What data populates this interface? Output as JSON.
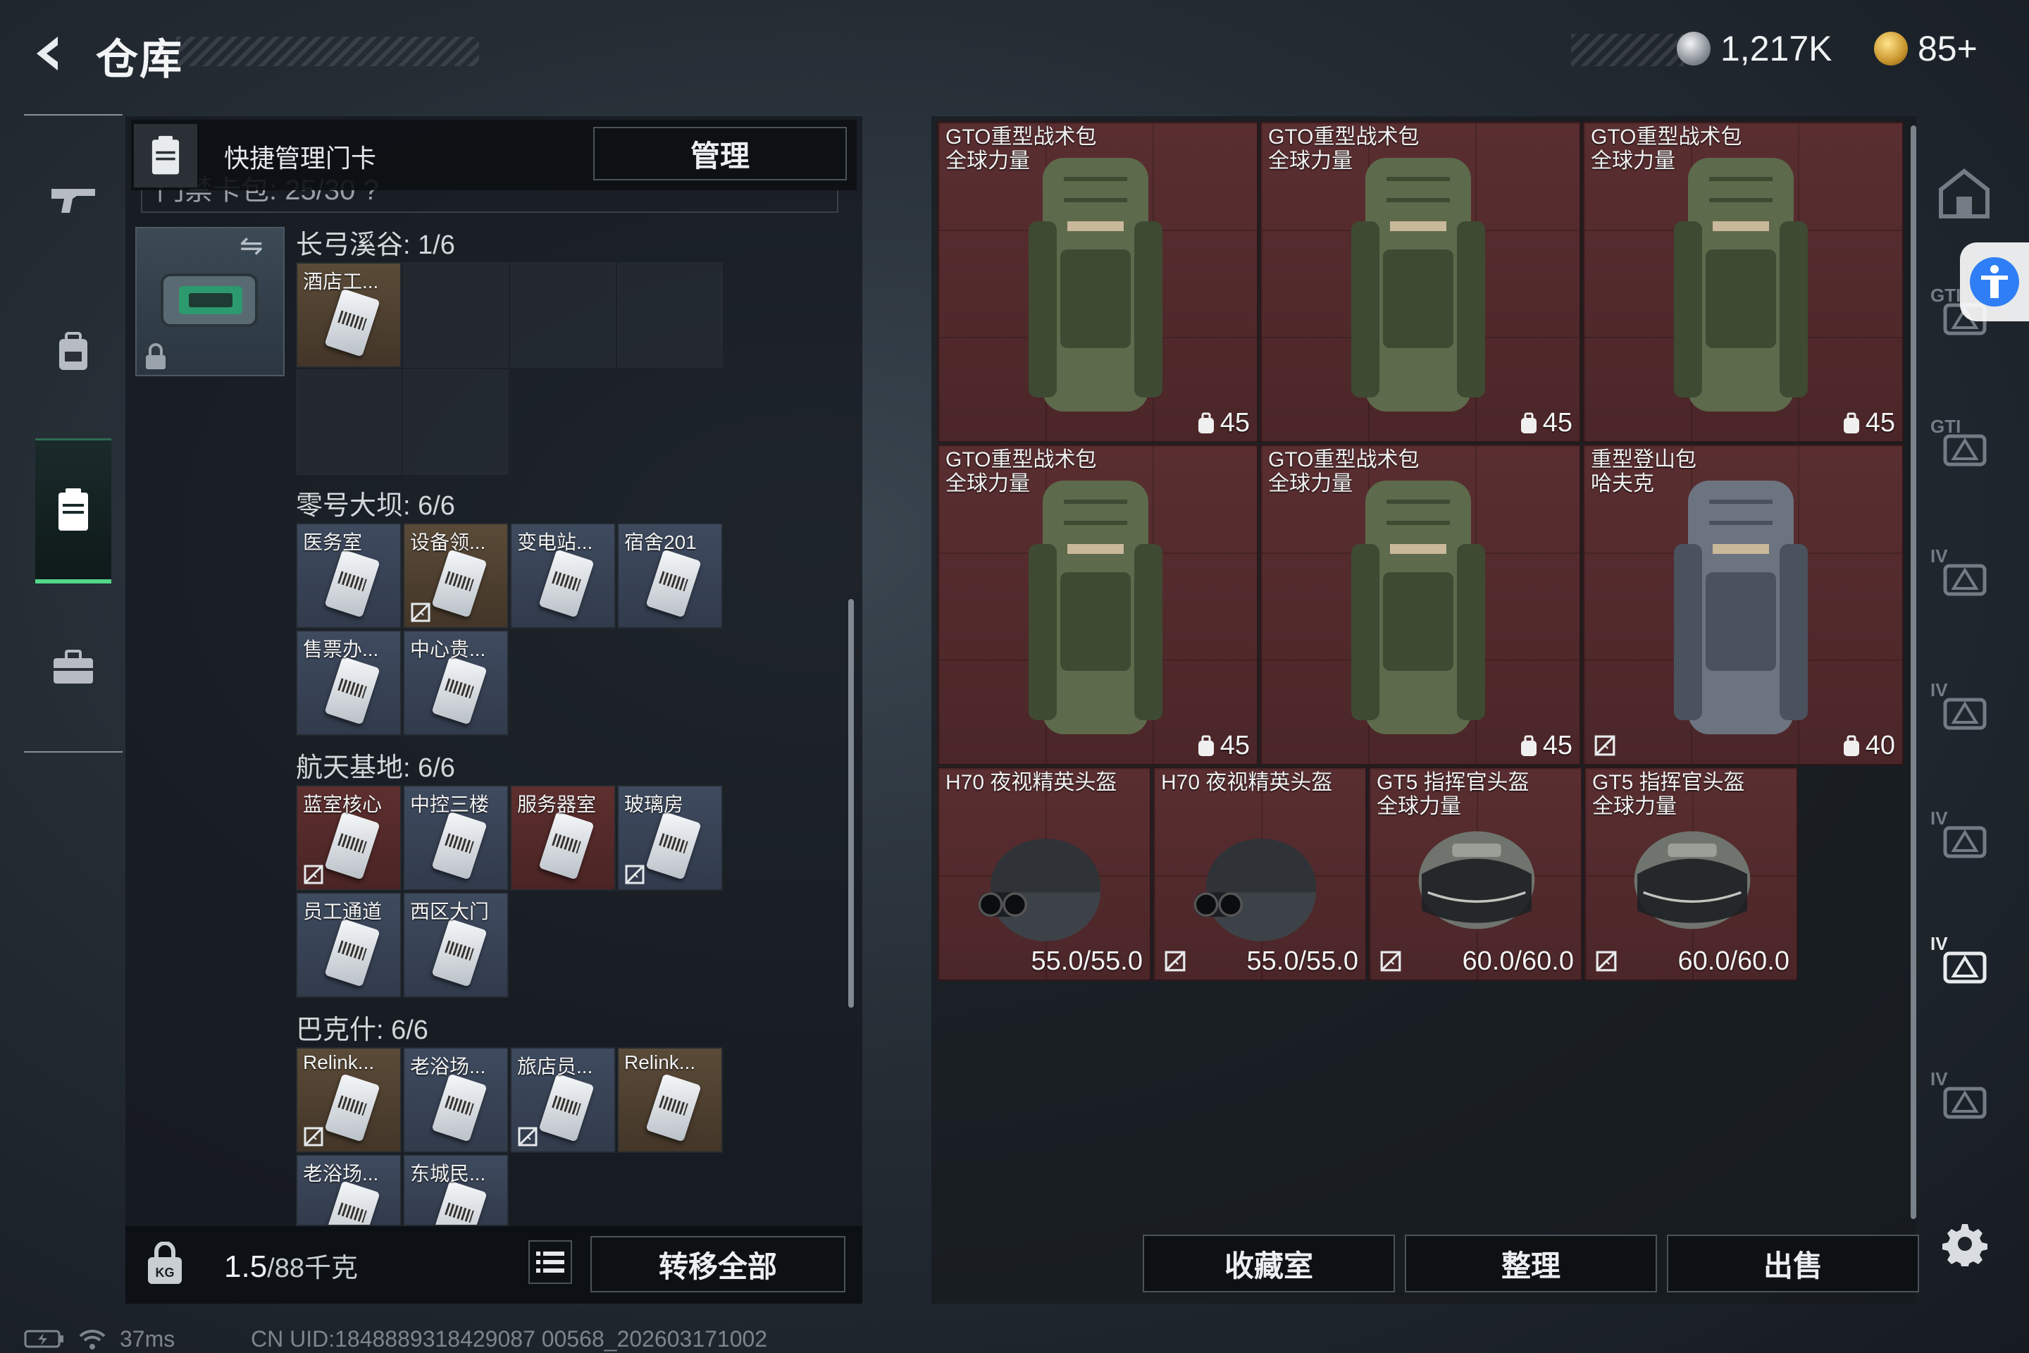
{
  "header": {
    "title": "仓库",
    "currency_primary": "1,217K",
    "currency_secondary": "85+",
    "currency_primary_icon": "silver-coin-icon",
    "currency_secondary_icon": "gold-coin-icon"
  },
  "nav": {
    "items": [
      {
        "name": "weapons",
        "icon": "rifle-icon"
      },
      {
        "name": "backpack",
        "icon": "backpack-icon"
      },
      {
        "name": "keycards",
        "icon": "keycard-case-icon",
        "active": true
      },
      {
        "name": "toolbox",
        "icon": "briefcase-icon"
      }
    ]
  },
  "left_panel": {
    "quick_label": "快捷管理门卡",
    "manage_label": "管理",
    "capacity_peek": "门禁卡包: 25/30 ?",
    "regions": [
      {
        "title": "长弓溪谷: 1/6",
        "slots": [
          {
            "label": "酒店工...",
            "tone": "gold",
            "card": true,
            "no_trade": false
          },
          {
            "label": "",
            "tone": "empty",
            "card": false,
            "no_trade": false
          },
          {
            "label": "",
            "tone": "empty",
            "card": false,
            "no_trade": false
          },
          {
            "label": "",
            "tone": "empty",
            "card": false,
            "no_trade": false
          },
          {
            "label": "",
            "tone": "empty",
            "card": false,
            "no_trade": false
          },
          {
            "label": "",
            "tone": "empty",
            "card": false,
            "no_trade": false
          }
        ]
      },
      {
        "title": "零号大坝: 6/6",
        "slots": [
          {
            "label": "医务室",
            "tone": "blue",
            "card": true,
            "no_trade": false
          },
          {
            "label": "设备领...",
            "tone": "gold",
            "card": true,
            "no_trade": true
          },
          {
            "label": "变电站...",
            "tone": "blue",
            "card": true,
            "no_trade": false
          },
          {
            "label": "宿舍201",
            "tone": "blue",
            "card": true,
            "no_trade": false
          },
          {
            "label": "售票办...",
            "tone": "blue",
            "card": true,
            "no_trade": false
          },
          {
            "label": "中心贵...",
            "tone": "blue",
            "card": true,
            "no_trade": false
          }
        ]
      },
      {
        "title": "航天基地: 6/6",
        "slots": [
          {
            "label": "蓝室核心",
            "tone": "red",
            "card": true,
            "no_trade": true
          },
          {
            "label": "中控三楼",
            "tone": "blue",
            "card": true,
            "no_trade": false
          },
          {
            "label": "服务器室",
            "tone": "red",
            "card": true,
            "no_trade": false
          },
          {
            "label": "玻璃房",
            "tone": "blue",
            "card": true,
            "no_trade": true
          },
          {
            "label": "员工通道",
            "tone": "blue",
            "card": true,
            "no_trade": false
          },
          {
            "label": "西区大门",
            "tone": "blue",
            "card": true,
            "no_trade": false
          }
        ]
      },
      {
        "title": "巴克什: 6/6",
        "slots": [
          {
            "label": "Relink...",
            "tone": "gold",
            "card": true,
            "no_trade": true
          },
          {
            "label": "老浴场...",
            "tone": "blue",
            "card": true,
            "no_trade": false
          },
          {
            "label": "旅店员...",
            "tone": "blue",
            "card": true,
            "no_trade": true
          },
          {
            "label": "Relink...",
            "tone": "gold",
            "card": true,
            "no_trade": false
          },
          {
            "label": "老浴场...",
            "tone": "blue",
            "card": true,
            "no_trade": false
          },
          {
            "label": "东城民...",
            "tone": "blue",
            "card": true,
            "no_trade": false
          }
        ]
      }
    ],
    "weight_value": "1.5",
    "weight_suffix": "/88千克",
    "transfer_label": "转移全部",
    "weight_icon": "weight-lock-icon",
    "list_icon": "list-icon"
  },
  "items": [
    {
      "name1": "GTO重型战术包",
      "name2": "全球力量",
      "stat": "45",
      "kind": "backpack",
      "no_trade": false
    },
    {
      "name1": "GTO重型战术包",
      "name2": "全球力量",
      "stat": "45",
      "kind": "backpack",
      "no_trade": false
    },
    {
      "name1": "GTO重型战术包",
      "name2": "全球力量",
      "stat": "45",
      "kind": "backpack",
      "no_trade": false
    },
    {
      "name1": "GTO重型战术包",
      "name2": "全球力量",
      "stat": "45",
      "kind": "backpack",
      "no_trade": false
    },
    {
      "name1": "GTO重型战术包",
      "name2": "全球力量",
      "stat": "45",
      "kind": "backpack",
      "no_trade": false
    },
    {
      "name1": "重型登山包",
      "name2": "哈夫克",
      "stat": "40",
      "kind": "backpack-camo",
      "no_trade": true
    },
    {
      "name1": "H70 夜视精英头盔",
      "name2": "",
      "stat": "55.0/55.0",
      "kind": "helmet-nv",
      "no_trade": false
    },
    {
      "name1": "H70 夜视精英头盔",
      "name2": "",
      "stat": "55.0/55.0",
      "kind": "helmet-nv",
      "no_trade": true
    },
    {
      "name1": "GT5 指挥官头盔",
      "name2": "全球力量",
      "stat": "60.0/60.0",
      "kind": "helmet-visor",
      "no_trade": true
    },
    {
      "name1": "GT5 指挥官头盔",
      "name2": "全球力量",
      "stat": "60.0/60.0",
      "kind": "helmet-visor",
      "no_trade": true
    }
  ],
  "filters": [
    {
      "icon": "home-filter-icon",
      "label": ""
    },
    {
      "icon": "gti-backpack-filter-icon",
      "label": "GTI"
    },
    {
      "icon": "gti-rig-filter-icon",
      "label": "GTI"
    },
    {
      "icon": "iv-armor-filter-icon",
      "label": "IV"
    },
    {
      "icon": "iv-case-filter-icon",
      "label": "IV"
    },
    {
      "icon": "iv-rifle-filter-icon",
      "label": "IV"
    },
    {
      "icon": "iv-armor-active-filter-icon",
      "label": "IV"
    },
    {
      "icon": "iv-gear-filter-icon",
      "label": "IV"
    }
  ],
  "actions": {
    "collection_label": "收藏室",
    "sort_label": "整理",
    "sell_label": "出售"
  },
  "status": {
    "ping": "37ms",
    "uid": "CN UID:1848889318429087 00568_202603171002"
  },
  "colors": {
    "accent_green": "#53d78a",
    "item_bg_red": "#5a2e31",
    "accessibility_blue": "#2f7ef5"
  }
}
